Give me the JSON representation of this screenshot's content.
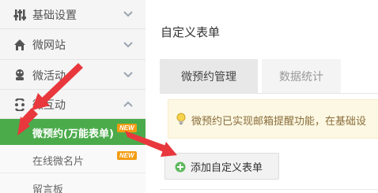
{
  "sidebar": {
    "items": [
      {
        "label": "基础设置",
        "icon": "wrench-icon"
      },
      {
        "label": "微网站",
        "icon": "home-icon"
      },
      {
        "label": "微活动",
        "icon": "activity-icon"
      },
      {
        "label": "微互动",
        "icon": "interaction-icon"
      }
    ],
    "subitems": [
      {
        "label": "微预约(万能表单)",
        "badge": "NEW",
        "active": true
      },
      {
        "label": "在线微名片",
        "badge": "NEW",
        "active": false
      },
      {
        "label": "留言板",
        "badge": "",
        "active": false
      }
    ]
  },
  "main": {
    "title": "自定义表单",
    "tabs": [
      {
        "label": "微预约管理",
        "active": true
      },
      {
        "label": "数据统计",
        "active": false
      }
    ],
    "notice": "微预约已实现邮箱提醒功能，在基础设",
    "add_button": "添加自定义表单"
  },
  "colors": {
    "accent_green": "#4bab4b",
    "badge_orange": "#f39c12",
    "arrow_red": "#e8383d",
    "notice_bg": "#fcf8e3"
  }
}
